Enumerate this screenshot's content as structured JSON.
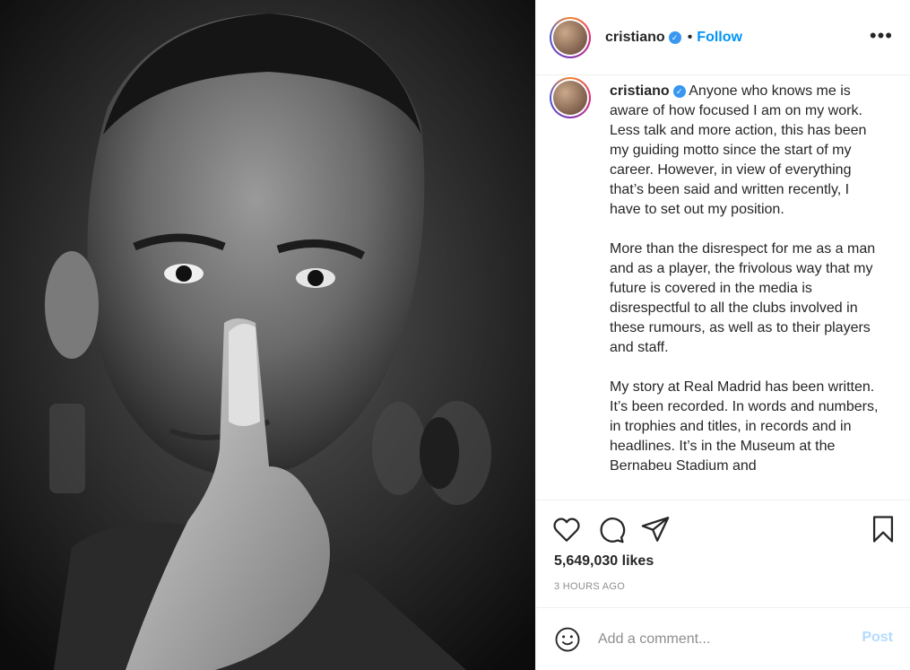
{
  "post": {
    "username": "cristiano",
    "verified_icon": "verified-badge-icon",
    "follow_label": "Follow",
    "separator": "•",
    "more_label": "•••"
  },
  "caption": {
    "username": "cristiano",
    "paragraphs": [
      "Anyone who knows me is aware of how focused I am on my work. Less talk and more action, this has been my guiding motto since the start of my career. However, in view of everything that’s been said and written recently, I have to set out my position.",
      "More than the disrespect for me as a man and as a player, the frivolous way that my future is covered in the media is disrespectful to all the clubs involved in these rumours, as well as to their players and staff.",
      "My story at Real Madrid has been written. It’s been recorded. In words and numbers, in trophies and titles, in records and in headlines. It’s in the Museum at the Bernabeu Stadium and"
    ]
  },
  "actions": {
    "like_icon": "heart-icon",
    "comment_icon": "comment-bubble-icon",
    "share_icon": "send-icon",
    "save_icon": "bookmark-icon",
    "likes": "5,649,030 likes",
    "time": "3 HOURS AGO"
  },
  "comment_box": {
    "emoji_icon": "smiley-icon",
    "placeholder": "Add a comment...",
    "post_label": "Post"
  },
  "colors": {
    "accent": "#0095f6",
    "post_disabled": "#b3dbff",
    "muted": "#8e8e8e",
    "text": "#262626",
    "border": "#efefef"
  }
}
